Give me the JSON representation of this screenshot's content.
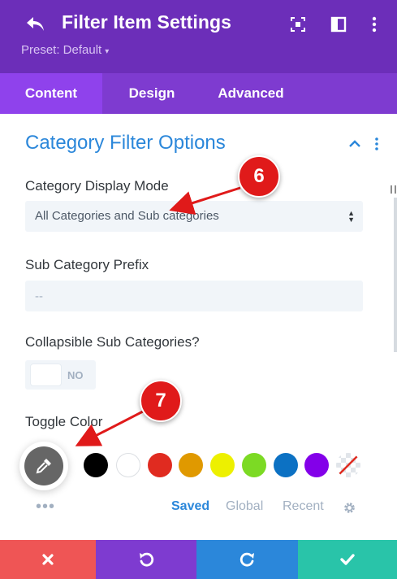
{
  "header": {
    "title": "Filter Item Settings",
    "preset_label": "Preset: Default",
    "preset_caret": "▾",
    "bg_color": "#6c2eb9"
  },
  "tabs": [
    {
      "label": "Content",
      "active": true
    },
    {
      "label": "Design",
      "active": false
    },
    {
      "label": "Advanced",
      "active": false
    }
  ],
  "section": {
    "title": "Category Filter Options"
  },
  "fields": {
    "display_mode": {
      "label": "Category Display Mode",
      "value": "All Categories and Sub categories"
    },
    "sub_prefix": {
      "label": "Sub Category Prefix",
      "placeholder": "--"
    },
    "collapsible": {
      "label": "Collapsible Sub Categories?",
      "state": "NO"
    },
    "toggle_color": {
      "label": "Toggle Color"
    }
  },
  "color_picker": {
    "swatches": [
      "#000000",
      "#ffffff",
      "#e02b20",
      "#e09900",
      "#edf000",
      "#7cda24",
      "#0c71c3",
      "#8300e9",
      "transparent"
    ],
    "more_dots": "•••",
    "tabs": [
      "Saved",
      "Global",
      "Recent"
    ],
    "active_tab": "Saved"
  },
  "footer": {
    "colors": {
      "cancel": "#ef5555",
      "undo": "#7e3bd0",
      "redo": "#2b87da",
      "save": "#29c4a9"
    }
  },
  "annotations": [
    {
      "number": "6"
    },
    {
      "number": "7"
    }
  ],
  "colors": {
    "accent_blue": "#2b87da",
    "tab_active": "#8f42ec",
    "annotation_red": "#e01a1a"
  }
}
